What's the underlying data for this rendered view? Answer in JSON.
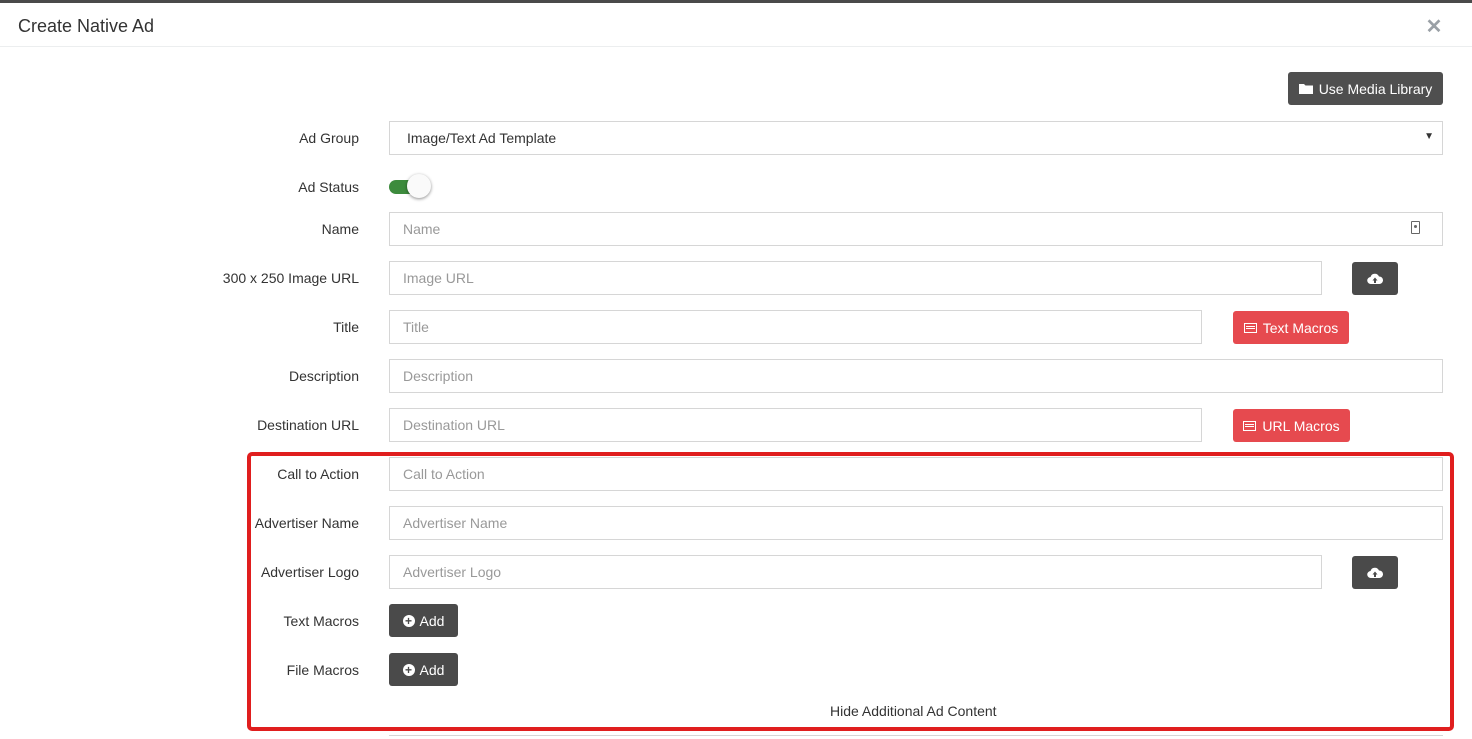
{
  "modal": {
    "title": "Create Native Ad",
    "close_icon": "close-icon"
  },
  "media_library_button": {
    "label": "Use Media Library",
    "icon": "folder-icon"
  },
  "fields": {
    "ad_group": {
      "label": "Ad Group",
      "value": "Image/Text Ad Template"
    },
    "ad_status": {
      "label": "Ad Status",
      "enabled": true
    },
    "name": {
      "label": "Name",
      "placeholder": "Name"
    },
    "image_url": {
      "label": "300 x 250 Image URL",
      "placeholder": "Image URL"
    },
    "title": {
      "label": "Title",
      "placeholder": "Title"
    },
    "description": {
      "label": "Description",
      "placeholder": "Description"
    },
    "destination_url": {
      "label": "Destination URL",
      "placeholder": "Destination URL"
    },
    "call_to_action": {
      "label": "Call to Action",
      "placeholder": "Call to Action"
    },
    "advertiser_name": {
      "label": "Advertiser Name",
      "placeholder": "Advertiser Name"
    },
    "advertiser_logo": {
      "label": "Advertiser Logo",
      "placeholder": "Advertiser Logo"
    },
    "text_macros": {
      "label": "Text Macros",
      "button": "Add"
    },
    "file_macros": {
      "label": "File Macros",
      "button": "Add"
    }
  },
  "buttons": {
    "text_macros": "Text Macros",
    "url_macros": "URL Macros"
  },
  "hide_additional": "Hide Additional Ad Content",
  "colors": {
    "red_button": "#e64a4f",
    "dark_button": "#4a4a4a",
    "toggle_on": "#3d8b3d",
    "highlight": "#e01e1e"
  }
}
